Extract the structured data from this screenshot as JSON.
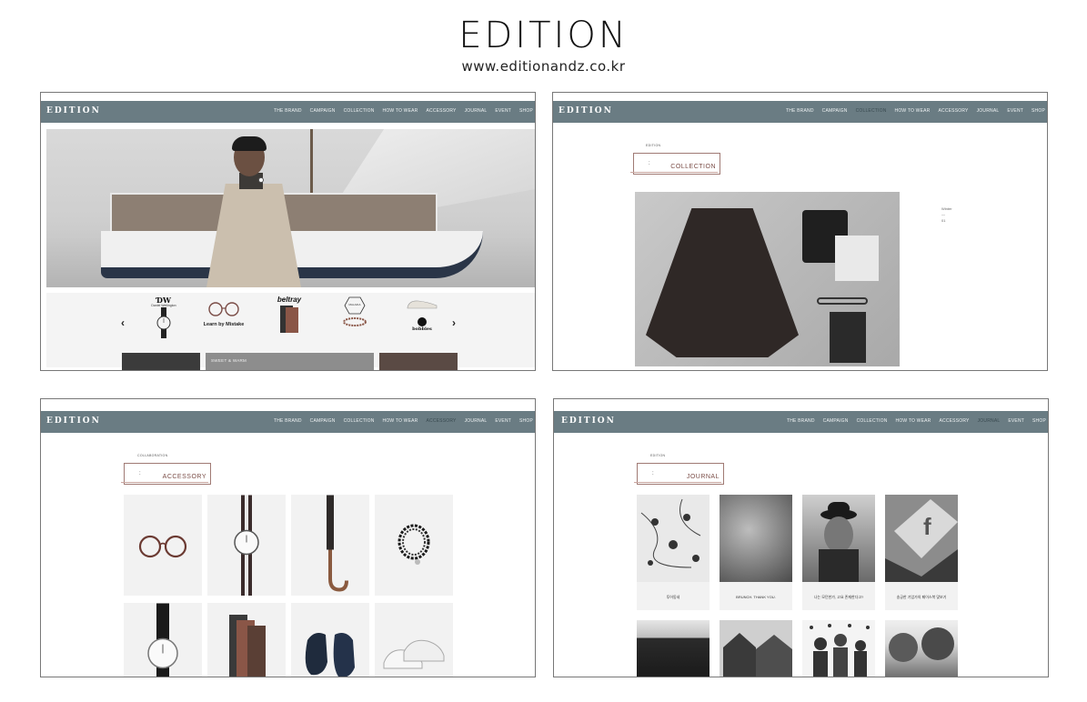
{
  "header": {
    "title": "EDITION",
    "url": "www.editionandz.co.kr"
  },
  "nav": {
    "logo": "EDITION",
    "items": [
      "THE BRAND",
      "CAMPAIGN",
      "COLLECTION",
      "HOW TO WEAR",
      "ACCESSORY",
      "JOURNAL",
      "EVENT",
      "SHOP"
    ]
  },
  "panel_home": {
    "carousel": {
      "prev": "‹",
      "next": "›",
      "items": [
        {
          "logo": "ƊW",
          "sub": "Daniel Wellington",
          "caption": ""
        },
        {
          "logo": "",
          "sub": "",
          "caption": "Learn by Mistake"
        },
        {
          "logo": "beltray",
          "sub": "",
          "caption": ""
        },
        {
          "logo": "MALAIKA",
          "sub": "",
          "caption": ""
        },
        {
          "logo": "bobbies",
          "sub": "",
          "caption": ""
        }
      ]
    },
    "strip_text": "SWEET & WARM"
  },
  "panel_collection": {
    "small_label": "EDITION",
    "colon": ":",
    "section_label": "COLLECTION",
    "side_note": [
      "Winter",
      "—",
      "01"
    ]
  },
  "panel_accessory": {
    "small_label": "COLLABORATION",
    "colon": ":",
    "section_label": "ACCESSORY"
  },
  "panel_journal": {
    "small_label": "EDITION",
    "colon": ":",
    "section_label": "JOURNAL",
    "captions": [
      "투어동네",
      "BRUNCH. THANK YOU.",
      "나는 모던한가, 고요 존재한다고?",
      "송궁한 기업가의 페이스북 맞보기"
    ]
  }
}
